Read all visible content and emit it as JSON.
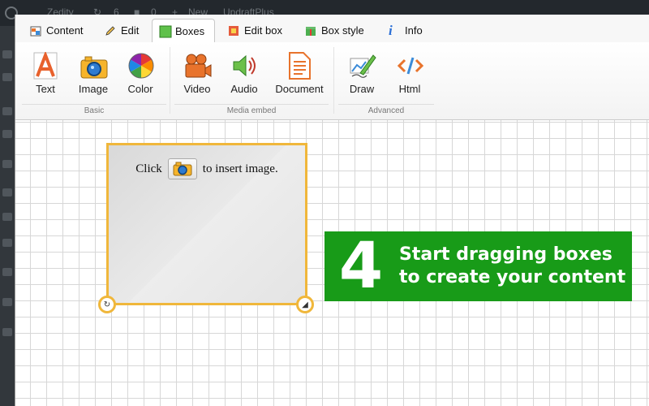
{
  "adminbar": {
    "site_name": "Zedity",
    "updates_count": "6",
    "comments_count": "0",
    "new_label": "New",
    "plugin_label": "UpdraftPlus"
  },
  "tabs": [
    {
      "label": "Content",
      "icon": "content-icon"
    },
    {
      "label": "Edit",
      "icon": "pencil-icon"
    },
    {
      "label": "Boxes",
      "icon": "boxes-icon",
      "active": true
    },
    {
      "label": "Edit box",
      "icon": "edit-box-icon"
    },
    {
      "label": "Box style",
      "icon": "box-style-icon"
    },
    {
      "label": "Info",
      "icon": "info-icon"
    }
  ],
  "ribbon": {
    "groups": [
      {
        "name": "Basic",
        "buttons": [
          {
            "label": "Text",
            "icon": "text-icon"
          },
          {
            "label": "Image",
            "icon": "camera-icon"
          },
          {
            "label": "Color",
            "icon": "color-wheel-icon"
          }
        ]
      },
      {
        "name": "Media embed",
        "buttons": [
          {
            "label": "Video",
            "icon": "video-camera-icon"
          },
          {
            "label": "Audio",
            "icon": "speaker-icon"
          },
          {
            "label": "Document",
            "icon": "document-icon"
          }
        ]
      },
      {
        "name": "Advanced",
        "buttons": [
          {
            "label": "Draw",
            "icon": "draw-icon"
          },
          {
            "label": "Html",
            "icon": "html-code-icon"
          }
        ]
      }
    ]
  },
  "box": {
    "text_before": "Click",
    "text_after": "to insert image."
  },
  "callout": {
    "number": "4",
    "line1": "Start dragging boxes",
    "line2": "to create your content"
  },
  "colors": {
    "accent_orange": "#f0b73b",
    "callout_green": "#189b18",
    "admin_dark": "#23282d"
  }
}
